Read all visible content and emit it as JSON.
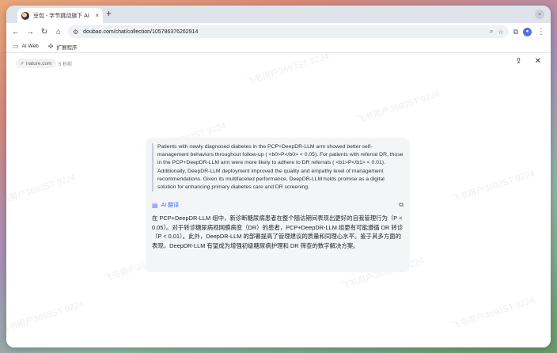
{
  "browser": {
    "tab_title": "豆包 - 字节跳动旗下 AI 智能助手",
    "tab_close": "×",
    "new_tab": "+",
    "url": "doubao.com/chat/collection/105786376262914",
    "bookmarks": [
      {
        "label": "AI Web",
        "icon": "folder-icon"
      },
      {
        "label": "扩展程序",
        "icon": "puzzle-icon"
      }
    ],
    "profile_initial": "●"
  },
  "source": {
    "domain": "nature.com",
    "time": "5 秒前"
  },
  "watermark": "飞书用户3693ST 9224",
  "card": {
    "quote": "Patients with newly diagnosed diabetes in the PCP+DeepDR-LLM arm showed better self-management behaviors throughout follow-up ( <b0>P</b0> < 0.05). For patients with referral DR, those in the PCP+DeepDR-LLM arm were more likely to adhere to DR referrals ( <b1>P</b1> < 0.01). Additionally, DeepDR-LLM deployment improved the quality and empathy level of management recommendations. Given its multifaceted performance, DeepDR-LLM holds promise as a digital solution for enhancing primary diabetes care and DR screening.",
    "ai_label": "AI 翻译",
    "translation": "在 PCP+DeepDR-LLM 组中，新诊断糖尿病患者在整个随访期间表现出更好的自我管理行为（P < 0.05）。对于转诊糖尿病视网膜病变（DR）的患者，PCP+DeepDR-LLM 组更有可能遵循 DR 转诊（P < 0.01）。此外，DeepDR-LLM 的部署提高了管理建议的质量和同理心水平。鉴于其多方面的表现，DeepDR-LLM 有望成为增强初级糖尿病护理和 DR 筛查的数字解决方案。"
  },
  "colors": {
    "accent": "#4a6cf7",
    "card_bg": "#f4f5f7"
  }
}
